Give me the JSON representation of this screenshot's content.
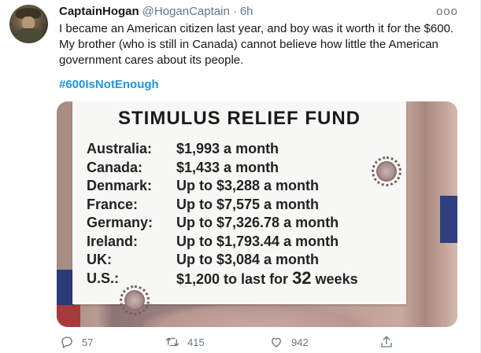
{
  "tweet": {
    "display_name": "CaptainHogan",
    "handle": "@HoganCaptain",
    "separator": "·",
    "time": "6h",
    "more_label": "ooo",
    "text": "I became an American citizen last year, and boy was it worth it for the $600. My brother (who is still in Canada) cannot believe how little the American government cares about its people.",
    "hashtag": "#600IsNotEnough"
  },
  "image": {
    "sign_title": "STIMULUS RELIEF FUND",
    "rows": [
      {
        "country": "Australia:",
        "amount": "$1,993 a month"
      },
      {
        "country": "Canada:",
        "amount": "$1,433 a month"
      },
      {
        "country": "Denmark:",
        "amount": "Up to $3,288 a month"
      },
      {
        "country": "France:",
        "amount": "Up to $7,575 a month"
      },
      {
        "country": "Germany:",
        "amount": "Up to $7,326.78 a month"
      },
      {
        "country": "Ireland:",
        "amount": "Up to $1,793.44 a month"
      },
      {
        "country": "UK:",
        "amount": "Up to $3,084 a month"
      },
      {
        "country": "U.S.:",
        "amount_pre": "$1,200 to last for ",
        "amount_big": "32",
        "amount_post": " weeks"
      }
    ]
  },
  "actions": {
    "reply_count": "57",
    "retweet_count": "415",
    "like_count": "942"
  },
  "icons": {
    "reply": "reply-icon",
    "retweet": "retweet-icon",
    "like": "heart-icon",
    "share": "share-icon",
    "more": "more-icon"
  }
}
